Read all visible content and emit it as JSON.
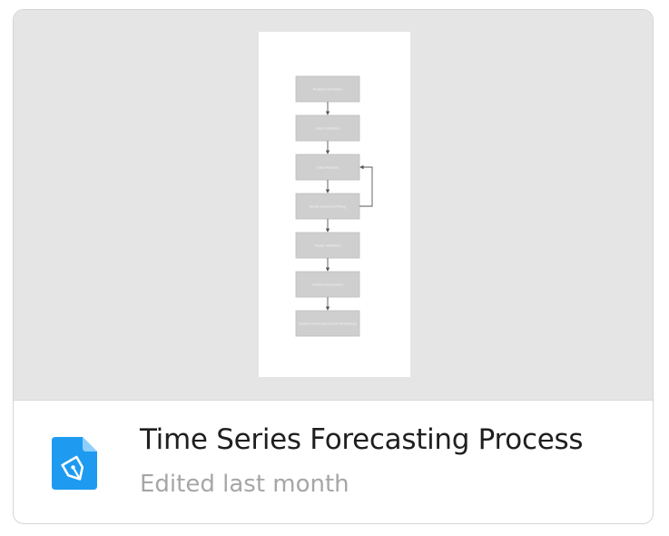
{
  "card": {
    "title": "Time Series Forecasting Process",
    "subtitle": "Edited last month",
    "icon": "pen-document-icon",
    "icon_color": "#1e9bf0"
  },
  "preview": {
    "background_color": "#e5e5e5",
    "steps": [
      "Problem Definition",
      "Data Collection",
      "Data Analysis",
      "Model Selection/Fitting",
      "Model Validation",
      "Model Deployment",
      "Model Performance/Drift Monitoring"
    ]
  }
}
